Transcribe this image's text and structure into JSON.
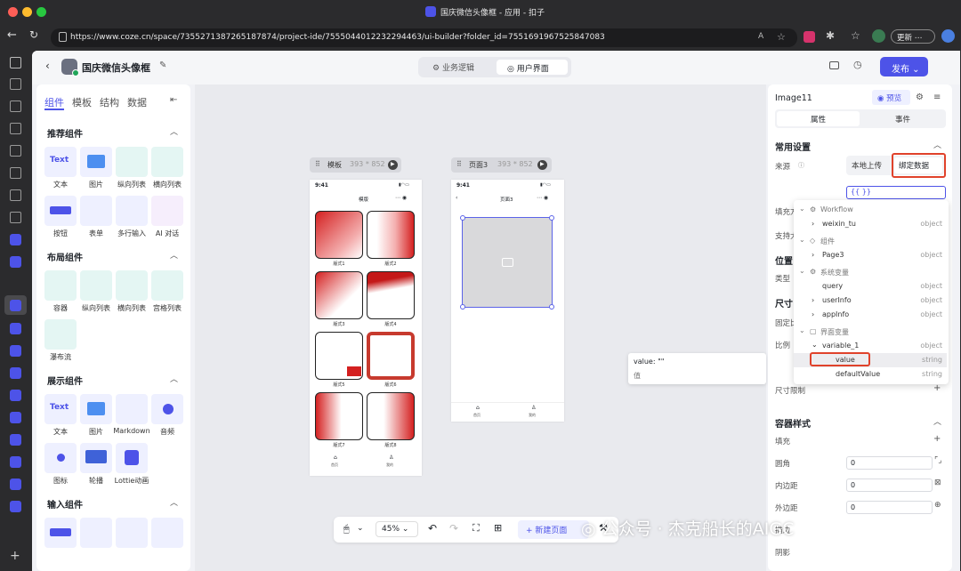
{
  "window": {
    "title": "国庆微信头像框 - 应用 - 扣子"
  },
  "browser": {
    "url": "https://www.coze.cn/space/7355271387265187874/project-ide/7555044012232294463/ui-builder?folder_id=7551691967525847083",
    "update_label": "更新"
  },
  "header": {
    "project_name": "国庆微信头像框",
    "tabs": [
      "业务逻辑",
      "用户界面"
    ],
    "publish_label": "发布"
  },
  "left_panel": {
    "tabs": [
      "组件",
      "模板",
      "结构",
      "数据"
    ],
    "sections": [
      {
        "title": "推荐组件",
        "items": [
          "文本",
          "图片",
          "纵向列表",
          "横向列表",
          "按钮",
          "表单",
          "多行输入",
          "AI 对话"
        ]
      },
      {
        "title": "布局组件",
        "items": [
          "容器",
          "纵向列表",
          "横向列表",
          "宫格列表",
          "瀑布流"
        ]
      },
      {
        "title": "展示组件",
        "items": [
          "文本",
          "图片",
          "Markdown",
          "音频",
          "图标",
          "轮播",
          "Lottie动画"
        ]
      },
      {
        "title": "输入组件",
        "items": []
      }
    ]
  },
  "canvas": {
    "template_frame": {
      "title": "模板",
      "size": "393 * 852",
      "time": "9:41",
      "page_title": "模版",
      "tiles": [
        "版式1",
        "版式2",
        "版式3",
        "版式4",
        "版式5",
        "版式6",
        "版式7",
        "版式8"
      ],
      "nav": [
        "首页",
        "我的"
      ]
    },
    "page_frame": {
      "title": "页面3",
      "size": "393 * 852",
      "time": "9:41",
      "page_title": "页面3",
      "nav": [
        "首页",
        "我的"
      ]
    },
    "tooltip": {
      "line1": "value: \"\"",
      "line2": "值"
    }
  },
  "bottom_toolbar": {
    "zoom": "45%",
    "new_page_label": "新建页面"
  },
  "watermark": "公众号 · 杰克船长的AIGC",
  "right_panel": {
    "element_name": "Image11",
    "preview_label": "预览",
    "tabs": [
      "属性",
      "事件"
    ],
    "common_title": "常用设置",
    "source_label": "来源",
    "source_options": [
      "本地上传",
      "绑定数据"
    ],
    "bind_value": "{{ }}",
    "labels": {
      "fill_mode": "填充方",
      "support": "支持大",
      "position": "位置",
      "type": "类型",
      "size": "尺寸",
      "fixed_ratio": "固定比",
      "ratio": "比例",
      "size_limit": "尺寸限制",
      "container_style": "容器样式",
      "fill": "填充",
      "radius": "圆角",
      "padding": "内边距",
      "margin": "外边距",
      "border": "描边",
      "shadow": "阴影"
    },
    "inputs": {
      "radius": "0",
      "padding": "0",
      "margin": "0"
    }
  },
  "dropdown": {
    "groups": [
      {
        "name": "Workflow",
        "items": [
          {
            "label": "weixin_tu",
            "type": "object"
          }
        ]
      },
      {
        "name": "组件",
        "items": [
          {
            "label": "Page3",
            "type": "object"
          }
        ]
      },
      {
        "name": "系统变量",
        "items": [
          {
            "label": "query",
            "type": "object"
          },
          {
            "label": "userInfo",
            "type": "object"
          },
          {
            "label": "appInfo",
            "type": "object"
          }
        ]
      },
      {
        "name": "界面变量",
        "items": [
          {
            "label": "variable_1",
            "type": "object"
          },
          {
            "label": "value",
            "type": "string"
          },
          {
            "label": "defaultValue",
            "type": "string"
          }
        ]
      }
    ]
  }
}
